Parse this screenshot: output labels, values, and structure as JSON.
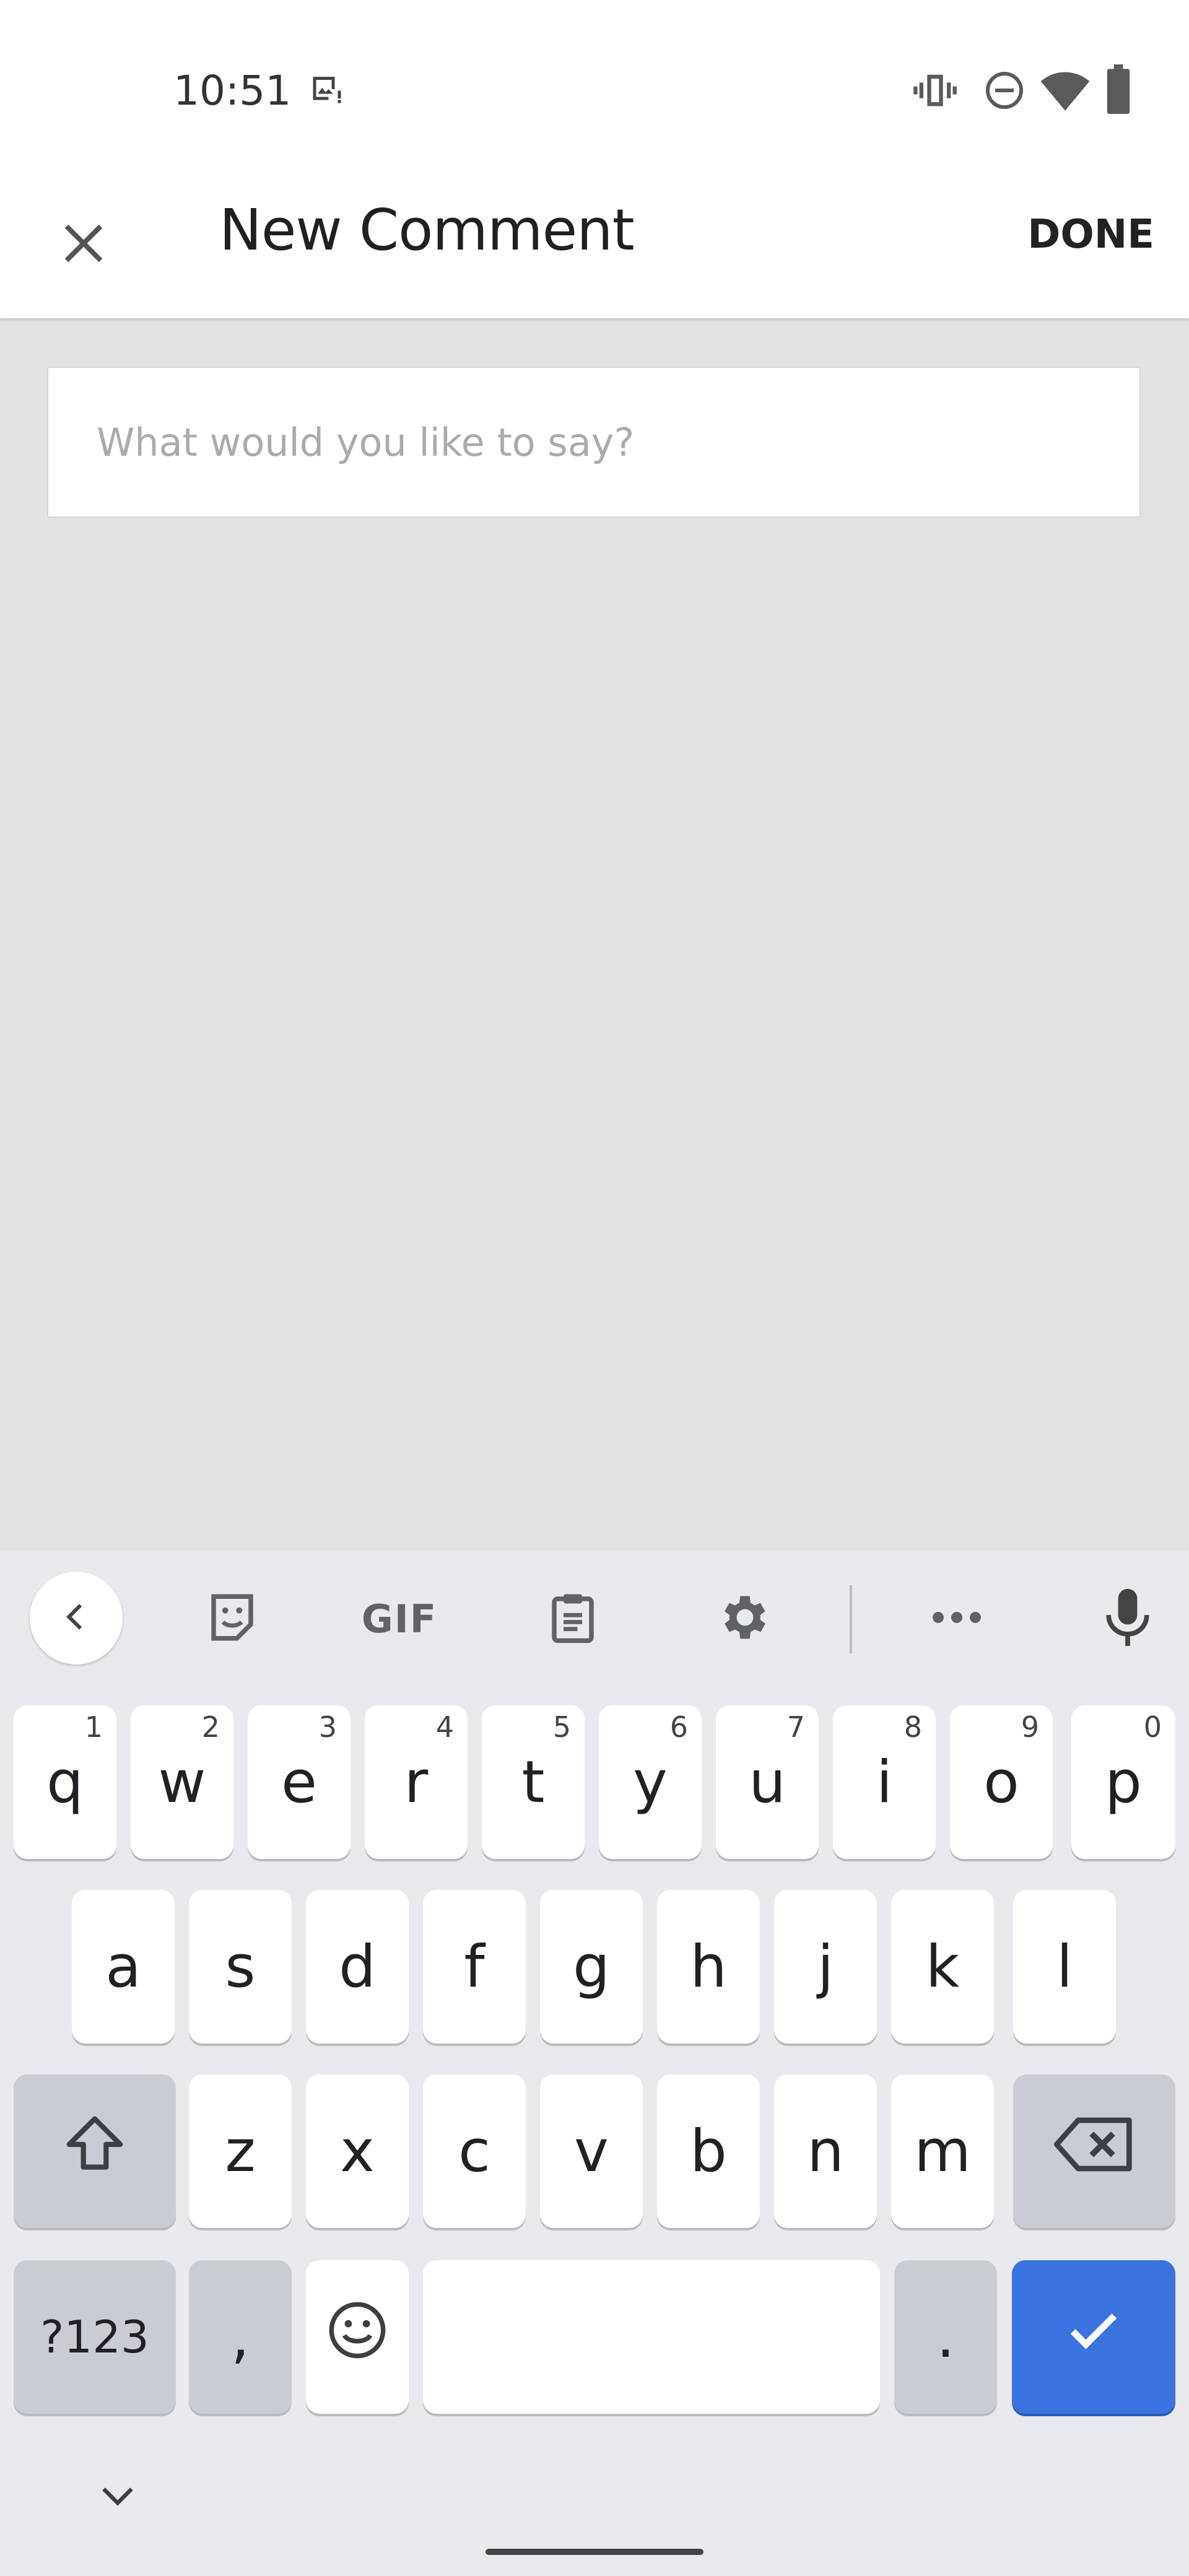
{
  "status_bar": {
    "time": "10:51",
    "icons": [
      "image-notification-icon",
      "vibrate-icon",
      "do-not-disturb-icon",
      "wifi-icon",
      "battery-icon"
    ]
  },
  "app_bar": {
    "title": "New Comment",
    "done_label": "DONE",
    "close_icon": "close-icon"
  },
  "comment": {
    "placeholder": "What would you like to say?",
    "value": ""
  },
  "keyboard": {
    "toolbar": [
      "back-icon",
      "sticker-icon",
      "gif",
      "clipboard-icon",
      "settings-icon",
      "more-icon",
      "mic-icon"
    ],
    "gif_label": "GIF",
    "row1": [
      {
        "letter": "q",
        "num": "1"
      },
      {
        "letter": "w",
        "num": "2"
      },
      {
        "letter": "e",
        "num": "3"
      },
      {
        "letter": "r",
        "num": "4"
      },
      {
        "letter": "t",
        "num": "5"
      },
      {
        "letter": "y",
        "num": "6"
      },
      {
        "letter": "u",
        "num": "7"
      },
      {
        "letter": "i",
        "num": "8"
      },
      {
        "letter": "o",
        "num": "9"
      },
      {
        "letter": "p",
        "num": "0"
      }
    ],
    "row2": [
      "a",
      "s",
      "d",
      "f",
      "g",
      "h",
      "j",
      "k",
      "l"
    ],
    "row3": [
      "z",
      "x",
      "c",
      "v",
      "b",
      "n",
      "m"
    ],
    "symbols_label": "?123",
    "comma": ",",
    "period": ".",
    "accent_color": "#3b73e0"
  }
}
